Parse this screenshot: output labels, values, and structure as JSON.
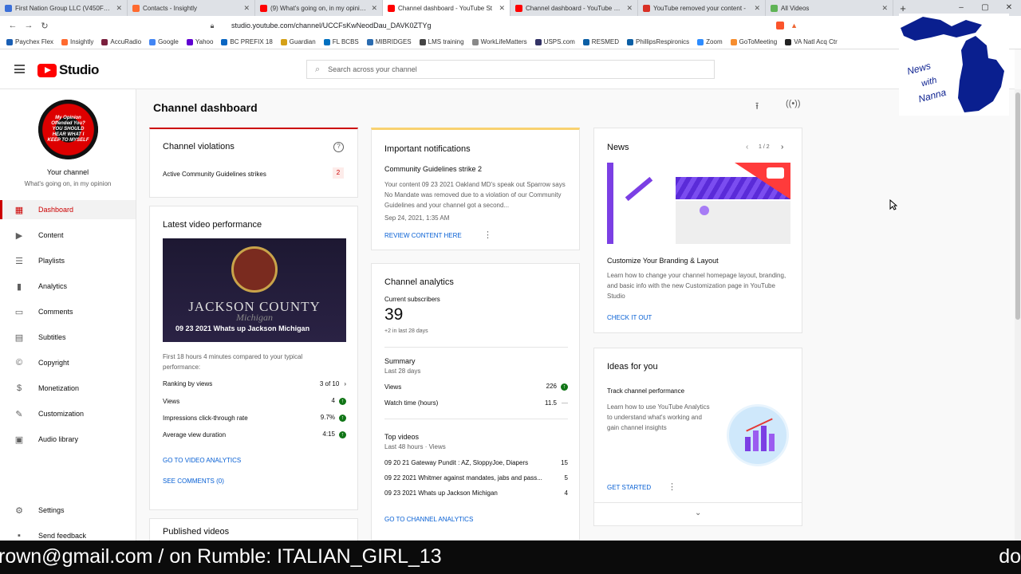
{
  "browser": {
    "tabs": [
      {
        "title": "First Nation Group LLC (V450F328), Di",
        "color": "#3b6fd8",
        "active": false
      },
      {
        "title": "Contacts - Insightly",
        "color": "#ff6a2f",
        "active": false
      },
      {
        "title": "(9) What's going on, in my opinion - ",
        "color": "#ff0000",
        "active": false
      },
      {
        "title": "Channel dashboard - YouTube St",
        "color": "#ff0000",
        "active": true
      },
      {
        "title": "Channel dashboard - YouTube Studio",
        "color": "#ff0000",
        "active": false
      },
      {
        "title": "YouTube removed your content - ",
        "color": "#d93025",
        "active": false
      },
      {
        "title": "All Videos",
        "color": "#5fb356",
        "active": false
      }
    ],
    "new_tab": "+",
    "url": "studio.youtube.com/channel/UCCFsKwNeodDau_DAVK0ZTYg",
    "bookmarks": [
      {
        "label": "Paychex Flex",
        "color": "#1a5fb4"
      },
      {
        "label": "Insightly",
        "color": "#ff6a2f"
      },
      {
        "label": "AccuRadio",
        "color": "#7a1f3d"
      },
      {
        "label": "Google",
        "color": "#4285f4"
      },
      {
        "label": "Yahoo",
        "color": "#6001d2"
      },
      {
        "label": "BC PREFIX 18",
        "color": "#0a66c2"
      },
      {
        "label": "Guardian",
        "color": "#d4a017"
      },
      {
        "label": "FL BCBS",
        "color": "#0070c0"
      },
      {
        "label": "MIBRIDGES",
        "color": "#2b6cb0"
      },
      {
        "label": "LMS training",
        "color": "#444444"
      },
      {
        "label": "WorkLifeMatters",
        "color": "#888888"
      },
      {
        "label": "USPS.com",
        "color": "#333366"
      },
      {
        "label": "RESMED",
        "color": "#0b5fa5"
      },
      {
        "label": "PhillipsRespironics",
        "color": "#0b5fa5"
      },
      {
        "label": "Zoom",
        "color": "#2d8cff"
      },
      {
        "label": "GoToMeeting",
        "color": "#f68d2e"
      },
      {
        "label": "VA Natl Acq Ctr",
        "color": "#222222"
      }
    ]
  },
  "header": {
    "logo_text": "Studio",
    "search_placeholder": "Search across your channel"
  },
  "sidebar": {
    "channel_label": "Your channel",
    "channel_name": "What's going on, in my opinion",
    "avatar_text": "My Opinion Offended You? YOU SHOULD HEAR WHAT I KEEP TO MYSELF",
    "items": [
      {
        "label": "Dashboard",
        "icon": "▦",
        "active": true
      },
      {
        "label": "Content",
        "icon": "▶"
      },
      {
        "label": "Playlists",
        "icon": "☰"
      },
      {
        "label": "Analytics",
        "icon": "▮"
      },
      {
        "label": "Comments",
        "icon": "▭"
      },
      {
        "label": "Subtitles",
        "icon": "▤"
      },
      {
        "label": "Copyright",
        "icon": "©"
      },
      {
        "label": "Monetization",
        "icon": "$"
      },
      {
        "label": "Customization",
        "icon": "✎"
      },
      {
        "label": "Audio library",
        "icon": "▣"
      }
    ],
    "settings": "Settings",
    "feedback": "Send feedback"
  },
  "dashboard": {
    "title": "Channel dashboard",
    "violations": {
      "title": "Channel violations",
      "row_label": "Active Community Guidelines strikes",
      "count": "2"
    },
    "latest": {
      "title": "Latest video performance",
      "thumb_county": "JACKSON COUNTY",
      "thumb_state": "Michigan",
      "thumb_title": "09 23 2021 Whats up Jackson Michigan",
      "compare": "First 18 hours 4 minutes compared to your typical performance:",
      "rows": [
        {
          "label": "Ranking by views",
          "value": "3 of 10"
        },
        {
          "label": "Views",
          "value": "4"
        },
        {
          "label": "Impressions click-through rate",
          "value": "9.7%"
        },
        {
          "label": "Average view duration",
          "value": "4:15"
        }
      ],
      "link_analytics": "GO TO VIDEO ANALYTICS",
      "link_comments": "SEE COMMENTS (0)"
    },
    "published": {
      "title": "Published videos"
    },
    "notifications": {
      "title": "Important notifications",
      "subtitle": "Community Guidelines strike 2",
      "body": "Your content 09 23 2021 Oakland MD's speak out Sparrow says No Mandate was removed due to a violation of our Community Guidelines and your channel got a second...",
      "date": "Sep 24, 2021, 1:35 AM",
      "link": "REVIEW CONTENT HERE"
    },
    "analytics": {
      "title": "Channel analytics",
      "subs_label": "Current subscribers",
      "subs_value": "39",
      "subs_delta": "+2 in last 28 days",
      "summary_title": "Summary",
      "summary_period": "Last 28 days",
      "views_label": "Views",
      "views_value": "226",
      "watch_label": "Watch time (hours)",
      "watch_value": "11.5",
      "watch_trend": "—",
      "top_title": "Top videos",
      "top_period": "Last 48 hours · Views",
      "top_videos": [
        {
          "title": "09 20 21 Gateway Pundit : AZ, SloppyJoe, Diapers",
          "views": "15"
        },
        {
          "title": "09 22 2021 Whitmer against mandates, jabs and pass...",
          "views": "5"
        },
        {
          "title": "09 23 2021 Whats up Jackson Michigan",
          "views": "4"
        }
      ],
      "link": "GO TO CHANNEL ANALYTICS"
    },
    "news": {
      "title": "News",
      "pager": "1 / 2",
      "headline": "Customize Your Branding & Layout",
      "body": "Learn how to change your channel homepage layout, branding, and basic info with the new Customization page in YouTube Studio",
      "link": "CHECK IT OUT"
    },
    "ideas": {
      "title": "Ideas for you",
      "subtitle": "Track channel performance",
      "body": "Learn how to use YouTube Analytics to understand what's working and gain channel insights",
      "link": "GET STARTED"
    }
  },
  "overlay": {
    "logo_line1": "News",
    "logo_line2": "with",
    "logo_line3": "Nanna",
    "ticker_left": "rown@gmail.com / on Rumble: ITALIAN_GIRL_13",
    "ticker_right": "do"
  },
  "colors": {
    "accent": "#cc0000",
    "link": "#065fd4",
    "ok": "#107516",
    "notification_bar": "#f9d270"
  }
}
